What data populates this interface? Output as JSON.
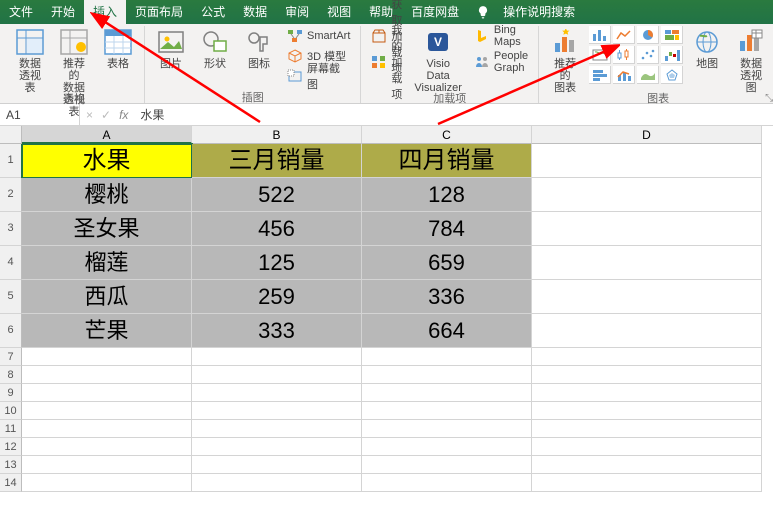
{
  "menubar": {
    "items": [
      "文件",
      "开始",
      "插入",
      "页面布局",
      "公式",
      "数据",
      "审阅",
      "视图",
      "帮助",
      "百度网盘"
    ],
    "active_index": 2,
    "tellme": "操作说明搜索"
  },
  "ribbon": {
    "groups": {
      "tables": {
        "label": "表格",
        "pivot": "数据\n透视表",
        "recommended": "推荐的\n数据透视表",
        "table": "表格"
      },
      "illustrations": {
        "label": "插图",
        "pictures": "图片",
        "shapes": "形状",
        "icons": "图标",
        "smartart": "SmartArt",
        "model3d": "3D 模型",
        "screenshot": "屏幕截图"
      },
      "addins": {
        "label": "加载项",
        "getaddin": "获取加载项",
        "myaddin": "我的加载项",
        "visio": "Visio Data\nVisualizer",
        "bingmaps": "Bing Maps",
        "peoplegraph": "People Graph"
      },
      "charts": {
        "label": "图表",
        "recommended": "推荐的\n图表",
        "map": "地图",
        "pivotchart": "数据透视图"
      }
    }
  },
  "cellref": {
    "name": "A1",
    "cancel": "×",
    "confirm": "✓",
    "fx": "fx",
    "formula": "水果"
  },
  "columns": {
    "A": "A",
    "B": "B",
    "C": "C",
    "D": "D"
  },
  "chart_data": {
    "type": "table",
    "headers": [
      "水果",
      "三月销量",
      "四月销量"
    ],
    "rows": [
      [
        "樱桃",
        522,
        128
      ],
      [
        "圣女果",
        456,
        784
      ],
      [
        "榴莲",
        125,
        659
      ],
      [
        "西瓜",
        259,
        336
      ],
      [
        "芒果",
        333,
        664
      ]
    ]
  }
}
